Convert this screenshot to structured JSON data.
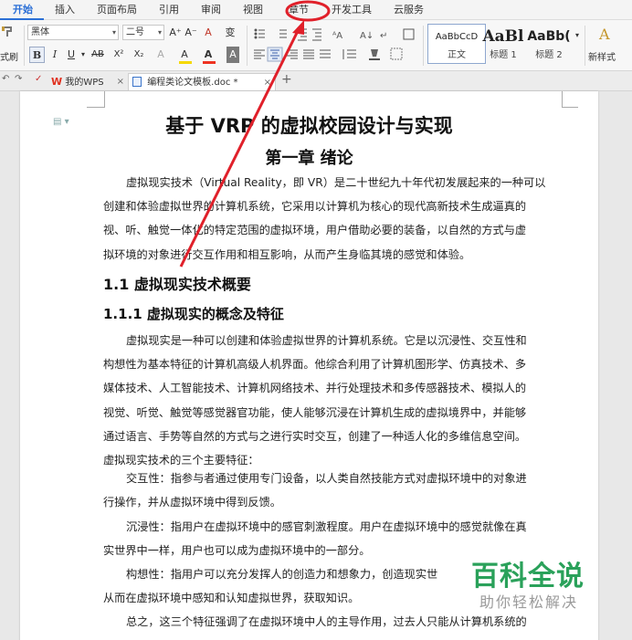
{
  "menu": {
    "tabs": [
      "开始",
      "插入",
      "页面布局",
      "引用",
      "审阅",
      "视图",
      "章节",
      "开发工具",
      "云服务"
    ],
    "active_index": 0,
    "highlighted_tab": "章节"
  },
  "ribbon": {
    "format_painter_label": "式刷",
    "font_name": "黑体",
    "font_size": "二号",
    "grow_font": "A⁺",
    "shrink_font": "A⁻",
    "clear_format": "A",
    "phonetic": "变",
    "bold": "B",
    "italic": "I",
    "underline": "U",
    "strikethrough": "AB",
    "superscript": "X²",
    "subscript": "X₂",
    "text_effect": "A",
    "highlight": "A",
    "font_color": "A",
    "char_shading": "A",
    "styles": [
      {
        "sample": "AaBbCcD",
        "name": "正文"
      },
      {
        "sample": "AaBl",
        "name": "标题 1"
      },
      {
        "sample": "AaBb(",
        "name": "标题 2"
      }
    ],
    "new_style_label": "新样式",
    "colors": {
      "font_color_bar": "#e32222",
      "highlight_bar": "#f5d800",
      "accent": "#2b6fd6"
    }
  },
  "doctabs": {
    "home_tab": "我的WPS",
    "doc_tab": "编程类论文模板.doc *",
    "close": "×",
    "new_tab": "+"
  },
  "document": {
    "title": "基于 VRP 的虚拟校园设计与实现",
    "chapter": "第一章  绪论",
    "para1": [
      "虚拟现实技术（Virtual Reality，即 VR）是二十世纪九十年代初发展起来的一种可以",
      "创建和体验虚拟世界的计算机系统，它采用以计算机为核心的现代高新技术生成逼真的",
      "视、听、触觉一体化的特定范围的虚拟环境，用户借助必要的装备，以自然的方式与虚",
      "拟环境的对象进行交互作用和相互影响，从而产生身临其境的感觉和体验。"
    ],
    "section_1_1": "1.1  虚拟现实技术概要",
    "section_1_1_1": "1.1.1  虚拟现实的概念及特征",
    "para2": [
      "虚拟现实是一种可以创建和体验虚拟世界的计算机系统。它是以沉浸性、交互性和",
      "构想性为基本特征的计算机高级人机界面。他综合利用了计算机图形学、仿真技术、多",
      "媒体技术、人工智能技术、计算机网络技术、并行处理技术和多传感器技术、模拟人的",
      "视觉、听觉、触觉等感觉器官功能，使人能够沉浸在计算机生成的虚拟境界中，并能够",
      "通过语言、手势等自然的方式与之进行实时交互，创建了一种适人化的多维信息空间。",
      "虚拟现实技术的三个主要特征："
    ],
    "para3": [
      "交互性：指参与者通过使用专门设备，以人类自然技能方式对虚拟环境中的对象进",
      "行操作，并从虚拟环境中得到反馈。"
    ],
    "para4": [
      "沉浸性：指用户在虚拟环境中的感官刺激程度。用户在虚拟环境中的感觉就像在真",
      "实世界中一样，用户也可以成为虚拟环境中的一部分。"
    ],
    "para5": [
      "构想性：指用户可以充分发挥人的创造力和想象力，创造现实世",
      "从而在虚拟环境中感知和认知虚拟世界，获取知识。"
    ],
    "para6": [
      "总之，这三个特征强调了在虚拟环境中人的主导作用，过去人只能从计算机系统的"
    ]
  },
  "watermark": {
    "brand": "百科全说",
    "slogan": "助你轻松解决"
  },
  "annotation_color": "#e0202a"
}
